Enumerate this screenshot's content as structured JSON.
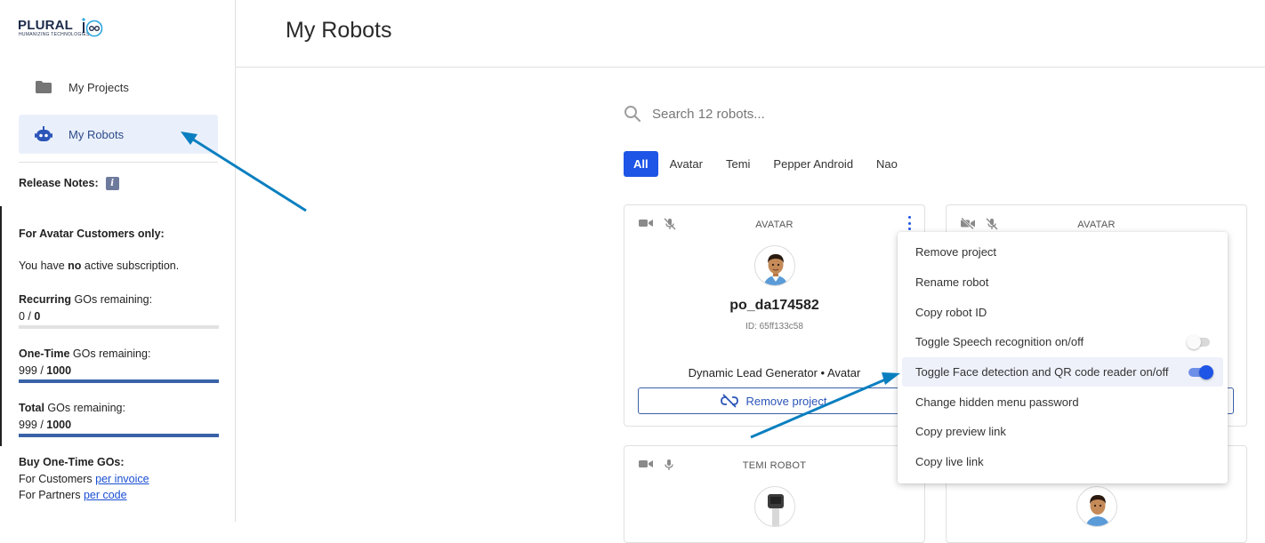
{
  "brand": {
    "name": "PLURAL",
    "tagline": "HUMANIZING TECHNOLOGIES"
  },
  "sidebar": {
    "items": [
      {
        "label": "My Projects",
        "icon": "folder-icon"
      },
      {
        "label": "My Robots",
        "icon": "robot-icon",
        "active": true
      }
    ],
    "release_notes_label": "Release Notes:",
    "info_badge": "i",
    "avatar_heading": "For Avatar Customers only:",
    "subscription": {
      "prefix": "You have ",
      "emphasis": "no",
      "suffix": " active subscription."
    },
    "quotas": [
      {
        "bold": "Recurring",
        "label": " GOs remaining:",
        "used": "0",
        "sep": " / ",
        "total": "0",
        "fill_fraction": 0
      },
      {
        "bold": "One-Time",
        "label": " GOs remaining:",
        "used": "999",
        "sep": " / ",
        "total": "1000",
        "fill_fraction": 0.999
      },
      {
        "bold": "Total",
        "label": " GOs remaining:",
        "used": "999",
        "sep": " / ",
        "total": "1000",
        "fill_fraction": 0.999
      }
    ],
    "buy": {
      "heading": "Buy One-Time GOs:",
      "customers_prefix": "For Customers ",
      "customers_link": "per invoice",
      "partners_prefix": "For Partners ",
      "partners_link": "per code"
    }
  },
  "header": {
    "title": "My Robots"
  },
  "search": {
    "placeholder": "Search 12 robots..."
  },
  "filters": [
    "All",
    "Avatar",
    "Temi",
    "Pepper Android",
    "Nao"
  ],
  "cards": [
    {
      "type": "AVATAR",
      "name": "po_da174582",
      "id": "ID: 65ff133c58",
      "project": "Dynamic Lead Generator • Avatar",
      "button": "Remove project"
    },
    {
      "type": "AVATAR"
    },
    {
      "type": "TEMI ROBOT"
    },
    {
      "type": ""
    }
  ],
  "context_menu": {
    "items": [
      {
        "label": "Remove project"
      },
      {
        "label": "Rename robot"
      },
      {
        "label": "Copy robot ID"
      },
      {
        "label": "Toggle Speech recognition on/off",
        "toggle": "off"
      },
      {
        "label": "Toggle Face detection and QR code reader on/off",
        "toggle": "on",
        "highlighted": true
      },
      {
        "label": "Change hidden menu password"
      },
      {
        "label": "Copy preview link"
      },
      {
        "label": "Copy live link"
      }
    ]
  },
  "colors": {
    "primary": "#1e55e6",
    "brand_navy": "#1c2b4a",
    "bar_fill": "#3a62a8",
    "annotation_arrow": "#0a7fc0"
  }
}
